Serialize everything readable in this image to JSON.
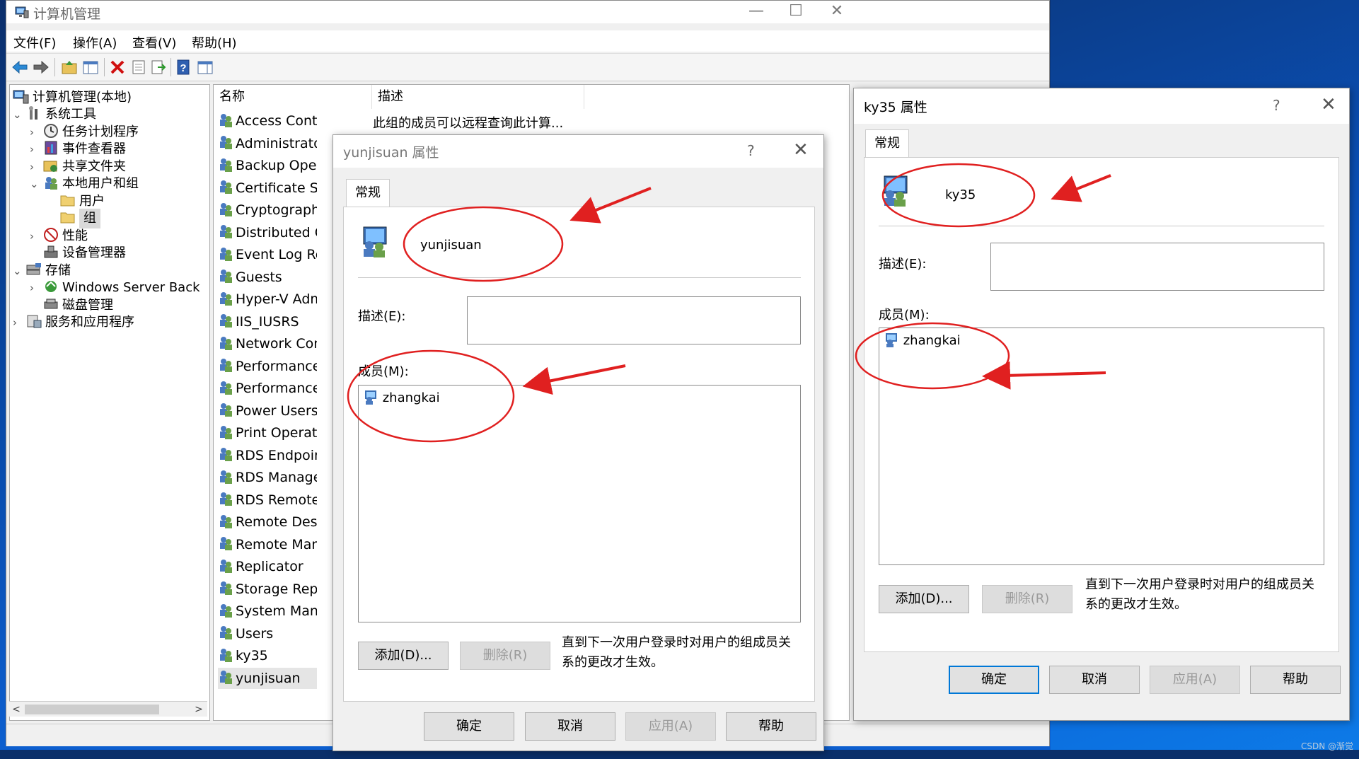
{
  "app": {
    "title": "计算机管理",
    "window_controls": {
      "minimize": "—",
      "maximize": "☐",
      "close": "✕"
    }
  },
  "menu": [
    "文件(F)",
    "操作(A)",
    "查看(V)",
    "帮助(H)"
  ],
  "toolbar_icons": [
    "back-arrow-icon",
    "forward-arrow-icon",
    "up-folder-icon",
    "show-hide-tree-icon",
    "delete-icon",
    "properties-icon",
    "export-icon",
    "help-icon",
    "action-pane-icon"
  ],
  "tree": {
    "root": "计算机管理(本地)",
    "system_tools": "系统工具",
    "task_scheduler": "任务计划程序",
    "event_viewer": "事件查看器",
    "shared_folders": "共享文件夹",
    "local_users_groups": "本地用户和组",
    "users": "用户",
    "groups": "组",
    "performance": "性能",
    "device_manager": "设备管理器",
    "storage": "存储",
    "windows_server_backup": "Windows Server Back",
    "disk_management": "磁盘管理",
    "services_apps": "服务和应用程序"
  },
  "list": {
    "col_name": "名称",
    "col_desc": "描述",
    "rows": [
      "Access Control Assi...",
      "Administrators",
      "Backup Operators",
      "Certificate Service",
      "Cryptographic Oper",
      "Distributed COM",
      "Event Log Readers",
      "Guests",
      "Hyper-V Administr",
      "IIS_IUSRS",
      "Network Configura",
      "Performance Log",
      "Performance Mon",
      "Power Users",
      "Print Operators",
      "RDS Endpoint Serv",
      "RDS Management",
      "RDS Remote Acc",
      "Remote Desktop",
      "Remote Manage",
      "Replicator",
      "Storage Replica",
      "System Managed",
      "Users",
      "ky35",
      "yunjisuan"
    ],
    "first_desc": "此组的成员可以远程查询此计算..."
  },
  "dialog1": {
    "title": "yunjisuan 属性",
    "help": "?",
    "close": "✕",
    "tab": "常规",
    "group_name": "yunjisuan",
    "desc_label": "描述(E):",
    "members_label": "成员(M):",
    "member": "zhangkai",
    "add": "添加(D)...",
    "remove": "删除(R)",
    "note_line1": "直到下一次用户登录时对用户的组成员关",
    "note_line2": "系的更改才生效。",
    "ok": "确定",
    "cancel": "取消",
    "apply": "应用(A)",
    "helpbtn": "帮助"
  },
  "dialog2": {
    "title": "ky35 属性",
    "help": "?",
    "close": "✕",
    "tab": "常规",
    "group_name": "ky35",
    "desc_label": "描述(E):",
    "members_label": "成员(M):",
    "member": "zhangkai",
    "add": "添加(D)...",
    "remove": "删除(R)",
    "note_line1": "直到下一次用户登录时对用户的组成员关",
    "note_line2": "系的更改才生效。",
    "ok": "确定",
    "cancel": "取消",
    "apply": "应用(A)",
    "helpbtn": "帮助"
  },
  "watermark": "CSDN @渐觉",
  "colors": {
    "annotation": "#e02020",
    "accent": "#0078d7"
  }
}
